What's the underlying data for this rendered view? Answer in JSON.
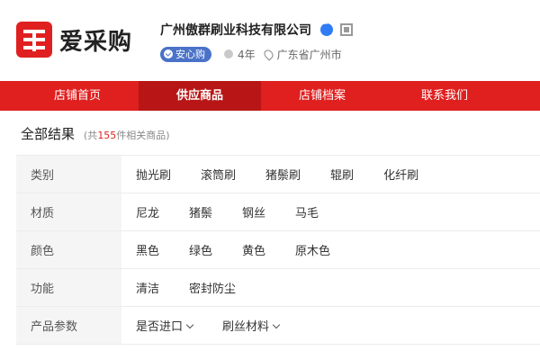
{
  "brand": {
    "logo_text": "爱采购",
    "accent": "#e01f1f"
  },
  "company": {
    "name": "广州傲群刷业科技有限公司",
    "badge": "安心购",
    "years": "4年",
    "location": "广东省广州市"
  },
  "nav": {
    "items": [
      {
        "label": "店铺首页"
      },
      {
        "label": "供应商品"
      },
      {
        "label": "店铺档案"
      },
      {
        "label": "联系我们"
      }
    ],
    "active": "供应商品"
  },
  "results": {
    "title": "全部结果",
    "count_prefix": "(共",
    "count": "155",
    "count_suffix": "件相关商品)"
  },
  "filters": [
    {
      "label": "类别",
      "values": [
        "抛光刷",
        "滚筒刷",
        "猪鬃刷",
        "辊刷",
        "化纤刷"
      ]
    },
    {
      "label": "材质",
      "values": [
        "尼龙",
        "猪鬃",
        "钢丝",
        "马毛"
      ]
    },
    {
      "label": "颜色",
      "values": [
        "黑色",
        "绿色",
        "黄色",
        "原木色"
      ]
    },
    {
      "label": "功能",
      "values": [
        "清洁",
        "密封防尘"
      ]
    },
    {
      "label": "产品参数",
      "values": [
        "是否进口",
        "刷丝材料"
      ]
    }
  ]
}
